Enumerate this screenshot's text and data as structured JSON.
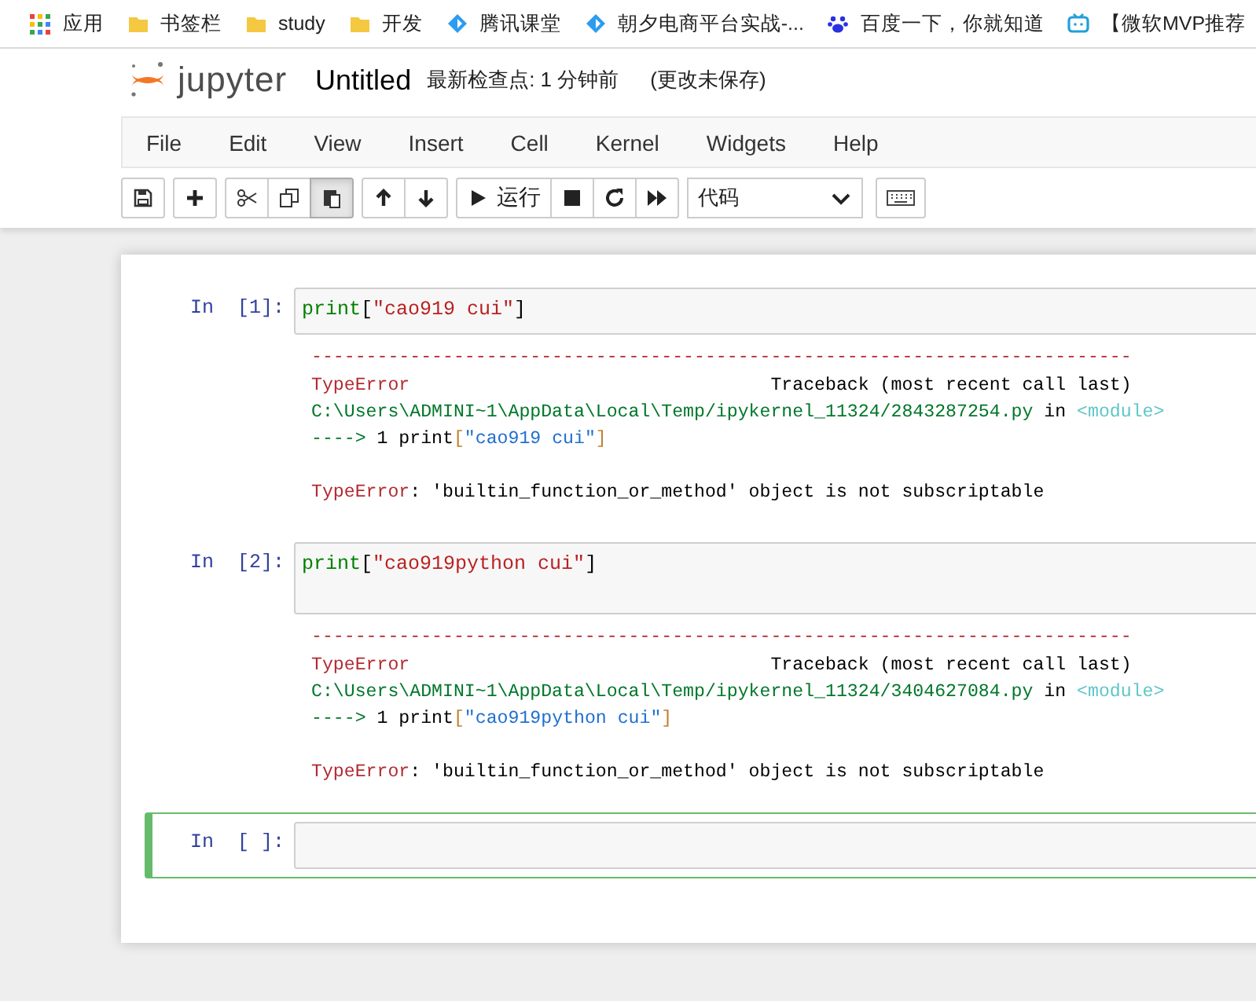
{
  "bookmarks": [
    {
      "kind": "apps",
      "label": "应用"
    },
    {
      "kind": "folder",
      "label": "书签栏"
    },
    {
      "kind": "folder",
      "label": "study"
    },
    {
      "kind": "folder",
      "label": "开发"
    },
    {
      "kind": "diamond",
      "label": "腾讯课堂"
    },
    {
      "kind": "diamond",
      "label": "朝夕电商平台实战-..."
    },
    {
      "kind": "paw",
      "label": "百度一下，你就知道"
    },
    {
      "kind": "tv",
      "label": "【微软MVP推荐"
    }
  ],
  "header": {
    "logo_text": "jupyter",
    "notebook_name": "Untitled",
    "checkpoint": "最新检查点: 1 分钟前",
    "save_status": "(更改未保存)"
  },
  "menu": [
    "File",
    "Edit",
    "View",
    "Insert",
    "Cell",
    "Kernel",
    "Widgets",
    "Help"
  ],
  "toolbar": [
    [
      {
        "kind": "save",
        "pressed": false
      }
    ],
    [
      {
        "kind": "add",
        "pressed": false
      }
    ],
    [
      {
        "kind": "cut",
        "pressed": false
      },
      {
        "kind": "copy",
        "pressed": false
      },
      {
        "kind": "paste",
        "pressed": true
      }
    ],
    [
      {
        "kind": "up",
        "pressed": false
      },
      {
        "kind": "down",
        "pressed": false
      }
    ],
    [
      {
        "kind": "run",
        "label": "运行",
        "pressed": false
      },
      {
        "kind": "stop",
        "pressed": false
      },
      {
        "kind": "restart",
        "pressed": false
      },
      {
        "kind": "fastforward",
        "pressed": false
      }
    ]
  ],
  "cell_type": "代码",
  "cells": [
    {
      "prompt": "In  [1]:",
      "selected": false,
      "code": [
        {
          "kind": "builtin",
          "text": "print"
        },
        {
          "kind": "punct",
          "text": "["
        },
        {
          "kind": "string",
          "text": "″cao919 cui″"
        },
        {
          "kind": "punct",
          "text": "]"
        }
      ],
      "tall": false,
      "output": {
        "rule": "---------------------------------------------------------------------------",
        "blocks": [
          [
            [
              {
                "kind": "error",
                "text": "TypeError"
              },
              {
                "kind": "plain",
                "text": "                                 Traceback (most recent call last)"
              }
            ],
            [
              {
                "kind": "path",
                "text": "C:\\Users\\ADMINI~1\\AppData\\Local\\Temp/ipykernel_11324/2843287254.py"
              },
              {
                "kind": "plain",
                "text": " in "
              },
              {
                "kind": "module",
                "text": "<module>"
              }
            ],
            [
              {
                "kind": "path",
                "text": "----> "
              },
              {
                "kind": "plain",
                "text": "1 print"
              },
              {
                "kind": "bracket",
                "text": "["
              },
              {
                "kind": "call",
                "text": "″cao919 cui″"
              },
              {
                "kind": "bracket",
                "text": "]"
              }
            ]
          ],
          [
            [
              {
                "kind": "error",
                "text": "TypeError"
              },
              {
                "kind": "plain",
                "text": ": 'builtin_function_or_method' object is not subscriptable"
              }
            ]
          ]
        ]
      }
    },
    {
      "prompt": "In  [2]:",
      "selected": false,
      "code": [
        {
          "kind": "builtin",
          "text": "print"
        },
        {
          "kind": "punct",
          "text": "["
        },
        {
          "kind": "string",
          "text": "″cao919python cui″"
        },
        {
          "kind": "punct",
          "text": "]"
        }
      ],
      "tall": true,
      "output": {
        "rule": "---------------------------------------------------------------------------",
        "blocks": [
          [
            [
              {
                "kind": "error",
                "text": "TypeError"
              },
              {
                "kind": "plain",
                "text": "                                 Traceback (most recent call last)"
              }
            ],
            [
              {
                "kind": "path",
                "text": "C:\\Users\\ADMINI~1\\AppData\\Local\\Temp/ipykernel_11324/3404627084.py"
              },
              {
                "kind": "plain",
                "text": " in "
              },
              {
                "kind": "module",
                "text": "<module>"
              }
            ],
            [
              {
                "kind": "path",
                "text": "----> "
              },
              {
                "kind": "plain",
                "text": "1 print"
              },
              {
                "kind": "bracket",
                "text": "["
              },
              {
                "kind": "call",
                "text": "″cao919python cui″"
              },
              {
                "kind": "bracket",
                "text": "]"
              }
            ]
          ],
          [
            [
              {
                "kind": "error",
                "text": "TypeError"
              },
              {
                "kind": "plain",
                "text": ": 'builtin_function_or_method' object is not subscriptable"
              }
            ]
          ]
        ]
      }
    },
    {
      "prompt": "In  [ ]:",
      "selected": true,
      "tall": false
    }
  ]
}
